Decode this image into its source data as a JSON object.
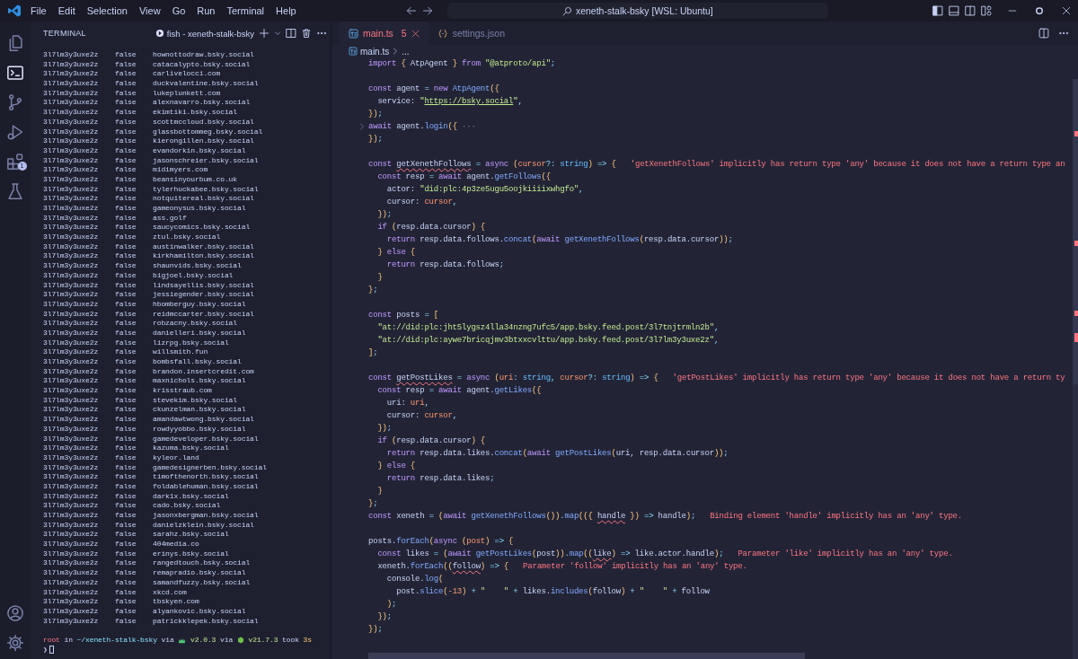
{
  "menu": [
    "File",
    "Edit",
    "Selection",
    "View",
    "Go",
    "Run",
    "Terminal",
    "Help"
  ],
  "command_center": "xeneth-stalk-bsky [WSL: Ubuntu]",
  "activity_bar": {
    "top": [
      {
        "kind": "explorer",
        "selected": false
      },
      {
        "kind": "terminal",
        "selected": true
      },
      {
        "kind": "source-control",
        "selected": false
      },
      {
        "kind": "run",
        "selected": false
      },
      {
        "kind": "extensions",
        "selected": false,
        "badge": "1"
      },
      {
        "kind": "testing",
        "selected": false
      }
    ],
    "bottom": [
      {
        "kind": "accounts"
      },
      {
        "kind": "manage"
      }
    ]
  },
  "terminal": {
    "title": "TERMINAL",
    "instance": "fish - xeneth-stalk-bsky",
    "rows": [
      [
        "3l7lm3y3uxe2z",
        "false",
        "hownottodraw.bsky.social"
      ],
      [
        "3l7lm3y3uxe2z",
        "false",
        "catacalypto.bsky.social"
      ],
      [
        "3l7lm3y3uxe2z",
        "false",
        "carlivelocci.com"
      ],
      [
        "3l7lm3y3uxe2z",
        "false",
        "duckvalentine.bsky.social"
      ],
      [
        "3l7lm3y3uxe2z",
        "false",
        "lukeplunkett.com"
      ],
      [
        "3l7lm3y3uxe2z",
        "false",
        "alexnavarro.bsky.social"
      ],
      [
        "3l7lm3y3uxe2z",
        "false",
        "ekimtiki.bsky.social"
      ],
      [
        "3l7lm3y3uxe2z",
        "false",
        "scottmccloud.bsky.social"
      ],
      [
        "3l7lm3y3uxe2z",
        "false",
        "glassbottommeg.bsky.social"
      ],
      [
        "3l7lm3y3uxe2z",
        "false",
        "kierongillen.bsky.social"
      ],
      [
        "3l7lm3y3uxe2z",
        "false",
        "evandorkin.bsky.social"
      ],
      [
        "3l7lm3y3uxe2z",
        "false",
        "jasonschreier.bsky.social"
      ],
      [
        "3l7lm3y3uxe2z",
        "false",
        "midimyers.com"
      ],
      [
        "3l7lm3y3uxe2z",
        "false",
        "beansinyourbum.co.uk"
      ],
      [
        "3l7lm3y3uxe2z",
        "false",
        "tylerhuckabee.bsky.social"
      ],
      [
        "3l7lm3y3uxe2z",
        "false",
        "notquitereal.bsky.social"
      ],
      [
        "3l7lm3y3uxe2z",
        "false",
        "gameonysus.bsky.social"
      ],
      [
        "3l7lm3y3uxe2z",
        "false",
        "ass.golf"
      ],
      [
        "3l7lm3y3uxe2z",
        "false",
        "saucycomics.bsky.social"
      ],
      [
        "3l7lm3y3uxe2z",
        "false",
        "ztul.bsky.social"
      ],
      [
        "3l7lm3y3uxe2z",
        "false",
        "austinwalker.bsky.social"
      ],
      [
        "3l7lm3y3uxe2z",
        "false",
        "kirkhamilton.bsky.social"
      ],
      [
        "3l7lm3y3uxe2z",
        "false",
        "shaunvids.bsky.social"
      ],
      [
        "3l7lm3y3uxe2z",
        "false",
        "bigjoel.bsky.social"
      ],
      [
        "3l7lm3y3uxe2z",
        "false",
        "lindsayellis.bsky.social"
      ],
      [
        "3l7lm3y3uxe2z",
        "false",
        "jessiegender.bsky.social"
      ],
      [
        "3l7lm3y3uxe2z",
        "false",
        "hbomberguy.bsky.social"
      ],
      [
        "3l7lm3y3uxe2z",
        "false",
        "reidmccarter.bsky.social"
      ],
      [
        "3l7lm3y3uxe2z",
        "false",
        "robzacny.bsky.social"
      ],
      [
        "3l7lm3y3uxe2z",
        "false",
        "danielleri.bsky.social"
      ],
      [
        "3l7lm3y3uxe2z",
        "false",
        "lizrpg.bsky.social"
      ],
      [
        "3l7lm3y3uxe2z",
        "false",
        "willsmith.fun"
      ],
      [
        "3l7lm3y3uxe2z",
        "false",
        "bombsfall.bsky.social"
      ],
      [
        "3l7lm3y3uxe2z",
        "false",
        "brandon.insertcredit.com"
      ],
      [
        "3l7lm3y3uxe2z",
        "false",
        "maxnichols.bsky.social"
      ],
      [
        "3l7lm3y3uxe2z",
        "false",
        "krisstraub.com"
      ],
      [
        "3l7lm3y3uxe2z",
        "false",
        "stevekim.bsky.social"
      ],
      [
        "3l7lm3y3uxe2z",
        "false",
        "ckunzelman.bsky.social"
      ],
      [
        "3l7lm3y3uxe2z",
        "false",
        "amandawtwong.bsky.social"
      ],
      [
        "3l7lm3y3uxe2z",
        "false",
        "rowdyyobbo.bsky.social"
      ],
      [
        "3l7lm3y3uxe2z",
        "false",
        "gamedeveloper.bsky.social"
      ],
      [
        "3l7lm3y3uxe2z",
        "false",
        "kazuma.bsky.social"
      ],
      [
        "3l7lm3y3uxe2z",
        "false",
        "kyleor.land"
      ],
      [
        "3l7lm3y3uxe2z",
        "false",
        "gamedesignerben.bsky.social"
      ],
      [
        "3l7lm3y3uxe2z",
        "false",
        "timofthenorth.bsky.social"
      ],
      [
        "3l7lm3y3uxe2z",
        "false",
        "foldablehuman.bsky.social"
      ],
      [
        "3l7lm3y3uxe2z",
        "false",
        "dark1x.bsky.social"
      ],
      [
        "3l7lm3y3uxe2z",
        "false",
        "cado.bsky.social"
      ],
      [
        "3l7lm3y3uxe2z",
        "false",
        "jasonxbergman.bsky.social"
      ],
      [
        "3l7lm3y3uxe2z",
        "false",
        "danielzklein.bsky.social"
      ],
      [
        "3l7lm3y3uxe2z",
        "false",
        "sarahz.bsky.social"
      ],
      [
        "3l7lm3y3uxe2z",
        "false",
        "404media.co"
      ],
      [
        "3l7lm3y3uxe2z",
        "false",
        "erinys.bsky.social"
      ],
      [
        "3l7lm3y3uxe2z",
        "false",
        "rangedtouch.bsky.social"
      ],
      [
        "3l7lm3y3uxe2z",
        "false",
        "remapradio.bsky.social"
      ],
      [
        "3l7lm3y3uxe2z",
        "false",
        "samandfuzzy.bsky.social"
      ],
      [
        "3l7lm3y3uxe2z",
        "false",
        "xkcd.com"
      ],
      [
        "3l7lm3y3uxe2z",
        "false",
        "tbskyen.com"
      ],
      [
        "3l7lm3y3uxe2z",
        "false",
        "alyankovic.bsky.social"
      ],
      [
        "3l7lm3y3uxe2z",
        "false",
        "patrickklepek.bsky.social"
      ]
    ],
    "prompt": [
      {
        "kind": "user",
        "text": "root"
      },
      {
        "kind": "plain",
        "text": "in"
      },
      {
        "kind": "path",
        "text": "~/xeneth-stalk-bsky"
      },
      {
        "kind": "plain",
        "text": "via"
      },
      {
        "kind": "bun-icon"
      },
      {
        "kind": "version",
        "text": "v2.0.3"
      },
      {
        "kind": "plain",
        "text": "via"
      },
      {
        "kind": "node-icon"
      },
      {
        "kind": "version",
        "text": "v21.7.3"
      },
      {
        "kind": "plain",
        "text": "took"
      },
      {
        "kind": "duration",
        "text": "3s"
      }
    ],
    "prompt_symbol": "❯"
  },
  "editor": {
    "tabs": [
      {
        "label": "main.ts",
        "kind": "ts",
        "problems": "5",
        "selected": true
      },
      {
        "label": "settings.json",
        "kind": "json",
        "selected": false
      }
    ],
    "breadcrumb": [
      "main.ts",
      "..."
    ],
    "lines": [
      {
        "kind": "code",
        "tokens": [
          {
            "text": "import ",
            "kind": "kw"
          },
          {
            "text": "{ ",
            "kind": "brace"
          },
          {
            "text": "AtpAgent ",
            "kind": "plain"
          },
          {
            "text": "} ",
            "kind": "brace"
          },
          {
            "text": "from ",
            "kind": "kw"
          },
          {
            "text": "\"@atproto/api\"",
            "kind": "str"
          },
          {
            "text": ";",
            "kind": "punc"
          }
        ]
      },
      {
        "kind": "blank"
      },
      {
        "kind": "code",
        "tokens": [
          {
            "text": "const ",
            "kind": "kw"
          },
          {
            "text": "agent ",
            "kind": "plain"
          },
          {
            "text": "= ",
            "kind": "punc"
          },
          {
            "text": "new ",
            "kind": "kw"
          },
          {
            "text": "AtpAgent",
            "kind": "fn"
          },
          {
            "text": "({",
            "kind": "brace"
          }
        ]
      },
      {
        "kind": "code",
        "tokens": [
          {
            "text": "  service: ",
            "kind": "plain"
          },
          {
            "text": "\"",
            "kind": "str"
          },
          {
            "text": "https://bsky.social",
            "kind": "link"
          },
          {
            "text": "\"",
            "kind": "str"
          },
          {
            "text": ",",
            "kind": "punc"
          }
        ]
      },
      {
        "kind": "code",
        "tokens": [
          {
            "text": "})",
            "kind": "brace"
          },
          {
            "text": ";",
            "kind": "punc"
          }
        ]
      },
      {
        "kind": "folded",
        "tokens": [
          {
            "text": "await ",
            "kind": "kw"
          },
          {
            "text": "agent.",
            "kind": "plain"
          },
          {
            "text": "login",
            "kind": "fn"
          },
          {
            "text": "({",
            "kind": "brace"
          },
          {
            "text": " ···",
            "kind": "fold"
          }
        ]
      },
      {
        "kind": "code",
        "tokens": [
          {
            "text": "})",
            "kind": "brace"
          },
          {
            "text": ";",
            "kind": "punc"
          }
        ]
      },
      {
        "kind": "blank"
      },
      {
        "kind": "code",
        "tokens": [
          {
            "text": "const ",
            "kind": "kw"
          },
          {
            "text": "getXenethFollows",
            "kind": "squiggle"
          },
          {
            "text": " = ",
            "kind": "punc"
          },
          {
            "text": "async ",
            "kind": "kw"
          },
          {
            "text": "(",
            "kind": "brace"
          },
          {
            "text": "cursor",
            "kind": "var"
          },
          {
            "text": "?: ",
            "kind": "punc"
          },
          {
            "text": "string",
            "kind": "type"
          },
          {
            "text": ") ",
            "kind": "brace"
          },
          {
            "text": "=> ",
            "kind": "punc"
          },
          {
            "text": "{",
            "kind": "brace"
          }
        ],
        "diagnostic": "'getXenethFollows' implicitly has return type 'any' because it does not have a return type an"
      },
      {
        "kind": "code",
        "tokens": [
          {
            "text": "  const ",
            "kind": "kw"
          },
          {
            "text": "resp ",
            "kind": "plain"
          },
          {
            "text": "= ",
            "kind": "punc"
          },
          {
            "text": "await ",
            "kind": "kw"
          },
          {
            "text": "agent.",
            "kind": "plain"
          },
          {
            "text": "getFollows",
            "kind": "fn"
          },
          {
            "text": "({",
            "kind": "brace"
          }
        ]
      },
      {
        "kind": "code",
        "tokens": [
          {
            "text": "    actor: ",
            "kind": "plain"
          },
          {
            "text": "\"did:plc:4p3ze5ugu5oojkiiiixwhgfo\"",
            "kind": "str"
          },
          {
            "text": ",",
            "kind": "punc"
          }
        ]
      },
      {
        "kind": "code",
        "tokens": [
          {
            "text": "    cursor: ",
            "kind": "plain"
          },
          {
            "text": "cursor",
            "kind": "var"
          },
          {
            "text": ",",
            "kind": "punc"
          }
        ]
      },
      {
        "kind": "code",
        "tokens": [
          {
            "text": "  })",
            "kind": "brace"
          },
          {
            "text": ";",
            "kind": "punc"
          }
        ]
      },
      {
        "kind": "code",
        "tokens": [
          {
            "text": "  if ",
            "kind": "kw"
          },
          {
            "text": "(",
            "kind": "brace"
          },
          {
            "text": "resp.data.cursor",
            "kind": "plain"
          },
          {
            "text": ") ",
            "kind": "brace"
          },
          {
            "text": "{",
            "kind": "brace"
          }
        ]
      },
      {
        "kind": "code",
        "tokens": [
          {
            "text": "    return ",
            "kind": "kw"
          },
          {
            "text": "resp.data.follows.",
            "kind": "plain"
          },
          {
            "text": "concat",
            "kind": "fn"
          },
          {
            "text": "(",
            "kind": "brace"
          },
          {
            "text": "await ",
            "kind": "kw"
          },
          {
            "text": "getXenethFollows",
            "kind": "fn"
          },
          {
            "text": "(",
            "kind": "brace"
          },
          {
            "text": "resp.data.cursor",
            "kind": "plain"
          },
          {
            "text": "))",
            "kind": "brace"
          },
          {
            "text": ";",
            "kind": "punc"
          }
        ]
      },
      {
        "kind": "code",
        "tokens": [
          {
            "text": "  } ",
            "kind": "brace"
          },
          {
            "text": "else ",
            "kind": "kw"
          },
          {
            "text": "{",
            "kind": "brace"
          }
        ]
      },
      {
        "kind": "code",
        "tokens": [
          {
            "text": "    return ",
            "kind": "kw"
          },
          {
            "text": "resp.data.follows",
            "kind": "plain"
          },
          {
            "text": ";",
            "kind": "punc"
          }
        ]
      },
      {
        "kind": "code",
        "tokens": [
          {
            "text": "  }",
            "kind": "brace"
          }
        ]
      },
      {
        "kind": "code",
        "tokens": [
          {
            "text": "}",
            "kind": "brace"
          },
          {
            "text": ";",
            "kind": "punc"
          }
        ]
      },
      {
        "kind": "blank"
      },
      {
        "kind": "code",
        "tokens": [
          {
            "text": "const ",
            "kind": "kw"
          },
          {
            "text": "posts ",
            "kind": "plain"
          },
          {
            "text": "= ",
            "kind": "punc"
          },
          {
            "text": "[",
            "kind": "brace"
          }
        ]
      },
      {
        "kind": "code",
        "tokens": [
          {
            "text": "  \"at://did:plc:jht5lygsz4lla34nzng7ufc5/app.bsky.feed.post/3l7tnjtrmln2b\"",
            "kind": "str"
          },
          {
            "text": ",",
            "kind": "punc"
          }
        ]
      },
      {
        "kind": "code",
        "tokens": [
          {
            "text": "  \"at://did:plc:aywe7bricqjmv3btxxcvlttu/app.bsky.feed.post/3l7lm3y3uxe2z\"",
            "kind": "str"
          },
          {
            "text": ",",
            "kind": "punc"
          }
        ]
      },
      {
        "kind": "code",
        "tokens": [
          {
            "text": "]",
            "kind": "brace"
          },
          {
            "text": ";",
            "kind": "punc"
          }
        ]
      },
      {
        "kind": "blank"
      },
      {
        "kind": "code",
        "tokens": [
          {
            "text": "const ",
            "kind": "kw"
          },
          {
            "text": "getPostLikes",
            "kind": "squiggle"
          },
          {
            "text": " = ",
            "kind": "punc"
          },
          {
            "text": "async ",
            "kind": "kw"
          },
          {
            "text": "(",
            "kind": "brace"
          },
          {
            "text": "uri",
            "kind": "var"
          },
          {
            "text": ": ",
            "kind": "punc"
          },
          {
            "text": "string",
            "kind": "type"
          },
          {
            "text": ", ",
            "kind": "punc"
          },
          {
            "text": "cursor",
            "kind": "var"
          },
          {
            "text": "?: ",
            "kind": "punc"
          },
          {
            "text": "string",
            "kind": "type"
          },
          {
            "text": ") ",
            "kind": "brace"
          },
          {
            "text": "=> ",
            "kind": "punc"
          },
          {
            "text": "{",
            "kind": "brace"
          }
        ],
        "diagnostic": "'getPostLikes' implicitly has return type 'any' because it does not have a return ty"
      },
      {
        "kind": "code",
        "tokens": [
          {
            "text": "  const ",
            "kind": "kw"
          },
          {
            "text": "resp ",
            "kind": "plain"
          },
          {
            "text": "= ",
            "kind": "punc"
          },
          {
            "text": "await ",
            "kind": "kw"
          },
          {
            "text": "agent.",
            "kind": "plain"
          },
          {
            "text": "getLikes",
            "kind": "fn"
          },
          {
            "text": "({",
            "kind": "brace"
          }
        ]
      },
      {
        "kind": "code",
        "tokens": [
          {
            "text": "    uri: ",
            "kind": "plain"
          },
          {
            "text": "uri",
            "kind": "var"
          },
          {
            "text": ",",
            "kind": "punc"
          }
        ]
      },
      {
        "kind": "code",
        "tokens": [
          {
            "text": "    cursor: ",
            "kind": "plain"
          },
          {
            "text": "cursor",
            "kind": "var"
          },
          {
            "text": ",",
            "kind": "punc"
          }
        ]
      },
      {
        "kind": "code",
        "tokens": [
          {
            "text": "  })",
            "kind": "brace"
          },
          {
            "text": ";",
            "kind": "punc"
          }
        ]
      },
      {
        "kind": "code",
        "tokens": [
          {
            "text": "  if ",
            "kind": "kw"
          },
          {
            "text": "(",
            "kind": "brace"
          },
          {
            "text": "resp.data.cursor",
            "kind": "plain"
          },
          {
            "text": ") ",
            "kind": "brace"
          },
          {
            "text": "{",
            "kind": "brace"
          }
        ]
      },
      {
        "kind": "code",
        "tokens": [
          {
            "text": "    return ",
            "kind": "kw"
          },
          {
            "text": "resp.data.likes.",
            "kind": "plain"
          },
          {
            "text": "concat",
            "kind": "fn"
          },
          {
            "text": "(",
            "kind": "brace"
          },
          {
            "text": "await ",
            "kind": "kw"
          },
          {
            "text": "getPostLikes",
            "kind": "fn"
          },
          {
            "text": "(",
            "kind": "brace"
          },
          {
            "text": "uri, resp.data.cursor",
            "kind": "plain"
          },
          {
            "text": "))",
            "kind": "brace"
          },
          {
            "text": ";",
            "kind": "punc"
          }
        ]
      },
      {
        "kind": "code",
        "tokens": [
          {
            "text": "  } ",
            "kind": "brace"
          },
          {
            "text": "else ",
            "kind": "kw"
          },
          {
            "text": "{",
            "kind": "brace"
          }
        ]
      },
      {
        "kind": "code",
        "tokens": [
          {
            "text": "    return ",
            "kind": "kw"
          },
          {
            "text": "resp.data.likes",
            "kind": "plain"
          },
          {
            "text": ";",
            "kind": "punc"
          }
        ]
      },
      {
        "kind": "code",
        "tokens": [
          {
            "text": "  }",
            "kind": "brace"
          }
        ]
      },
      {
        "kind": "code",
        "tokens": [
          {
            "text": "}",
            "kind": "brace"
          },
          {
            "text": ";",
            "kind": "punc"
          }
        ]
      },
      {
        "kind": "code",
        "tokens": [
          {
            "text": "const ",
            "kind": "kw"
          },
          {
            "text": "xeneth ",
            "kind": "plain"
          },
          {
            "text": "= ",
            "kind": "punc"
          },
          {
            "text": "(",
            "kind": "brace"
          },
          {
            "text": "await ",
            "kind": "kw"
          },
          {
            "text": "getXenethFollows",
            "kind": "fn"
          },
          {
            "text": "())",
            "kind": "brace"
          },
          {
            "text": ".",
            "kind": "punc"
          },
          {
            "text": "map",
            "kind": "fn"
          },
          {
            "text": "(({ ",
            "kind": "brace"
          },
          {
            "text": "handle",
            "kind": "squiggle"
          },
          {
            "text": " }) ",
            "kind": "brace"
          },
          {
            "text": "=> ",
            "kind": "punc"
          },
          {
            "text": "handle",
            "kind": "plain"
          },
          {
            "text": ")",
            "kind": "brace"
          },
          {
            "text": ";",
            "kind": "punc"
          }
        ],
        "diagnostic": "Binding element 'handle' implicitly has an 'any' type."
      },
      {
        "kind": "blank"
      },
      {
        "kind": "code",
        "tokens": [
          {
            "text": "posts.",
            "kind": "plain"
          },
          {
            "text": "forEach",
            "kind": "fn"
          },
          {
            "text": "(",
            "kind": "brace"
          },
          {
            "text": "async ",
            "kind": "kw"
          },
          {
            "text": "(",
            "kind": "brace"
          },
          {
            "text": "post",
            "kind": "var"
          },
          {
            "text": ") ",
            "kind": "brace"
          },
          {
            "text": "=> ",
            "kind": "punc"
          },
          {
            "text": "{",
            "kind": "brace"
          }
        ]
      },
      {
        "kind": "code",
        "tokens": [
          {
            "text": "  const ",
            "kind": "kw"
          },
          {
            "text": "likes ",
            "kind": "plain"
          },
          {
            "text": "= ",
            "kind": "punc"
          },
          {
            "text": "(",
            "kind": "brace"
          },
          {
            "text": "await ",
            "kind": "kw"
          },
          {
            "text": "getPostLikes",
            "kind": "fn"
          },
          {
            "text": "(",
            "kind": "brace"
          },
          {
            "text": "post",
            "kind": "plain"
          },
          {
            "text": "))",
            "kind": "brace"
          },
          {
            "text": ".",
            "kind": "punc"
          },
          {
            "text": "map",
            "kind": "fn"
          },
          {
            "text": "((",
            "kind": "brace"
          },
          {
            "text": "like",
            "kind": "squiggle"
          },
          {
            "text": ") ",
            "kind": "brace"
          },
          {
            "text": "=> ",
            "kind": "punc"
          },
          {
            "text": "like.actor.handle",
            "kind": "plain"
          },
          {
            "text": ")",
            "kind": "brace"
          },
          {
            "text": ";",
            "kind": "punc"
          }
        ],
        "diagnostic": "Parameter 'like' implicitly has an 'any' type."
      },
      {
        "kind": "code",
        "tokens": [
          {
            "text": "  xeneth.",
            "kind": "plain"
          },
          {
            "text": "forEach",
            "kind": "fn"
          },
          {
            "text": "((",
            "kind": "brace"
          },
          {
            "text": "follow",
            "kind": "squiggle"
          },
          {
            "text": ") ",
            "kind": "brace"
          },
          {
            "text": "=> ",
            "kind": "punc"
          },
          {
            "text": "{",
            "kind": "brace"
          }
        ],
        "diagnostic": "Parameter 'follow' implicitly has an 'any' type."
      },
      {
        "kind": "code",
        "tokens": [
          {
            "text": "    console.",
            "kind": "plain"
          },
          {
            "text": "log",
            "kind": "fn"
          },
          {
            "text": "(",
            "kind": "brace"
          }
        ]
      },
      {
        "kind": "code",
        "tokens": [
          {
            "text": "      post.",
            "kind": "plain"
          },
          {
            "text": "slice",
            "kind": "fn"
          },
          {
            "text": "(",
            "kind": "brace"
          },
          {
            "text": "-13",
            "kind": "num"
          },
          {
            "text": ") ",
            "kind": "brace"
          },
          {
            "text": "+ ",
            "kind": "punc"
          },
          {
            "text": "\"    \"",
            "kind": "str"
          },
          {
            "text": " + ",
            "kind": "punc"
          },
          {
            "text": "likes.",
            "kind": "plain"
          },
          {
            "text": "includes",
            "kind": "fn"
          },
          {
            "text": "(",
            "kind": "brace"
          },
          {
            "text": "follow",
            "kind": "plain"
          },
          {
            "text": ") ",
            "kind": "brace"
          },
          {
            "text": "+ ",
            "kind": "punc"
          },
          {
            "text": "\"    \"",
            "kind": "str"
          },
          {
            "text": " + ",
            "kind": "punc"
          },
          {
            "text": "follow",
            "kind": "plain"
          }
        ]
      },
      {
        "kind": "code",
        "tokens": [
          {
            "text": "    )",
            "kind": "brace"
          },
          {
            "text": ";",
            "kind": "punc"
          }
        ]
      },
      {
        "kind": "code",
        "tokens": [
          {
            "text": "  })",
            "kind": "brace"
          },
          {
            "text": ";",
            "kind": "punc"
          }
        ]
      },
      {
        "kind": "code",
        "tokens": [
          {
            "text": "})",
            "kind": "brace"
          },
          {
            "text": ";",
            "kind": "punc"
          }
        ]
      }
    ]
  }
}
